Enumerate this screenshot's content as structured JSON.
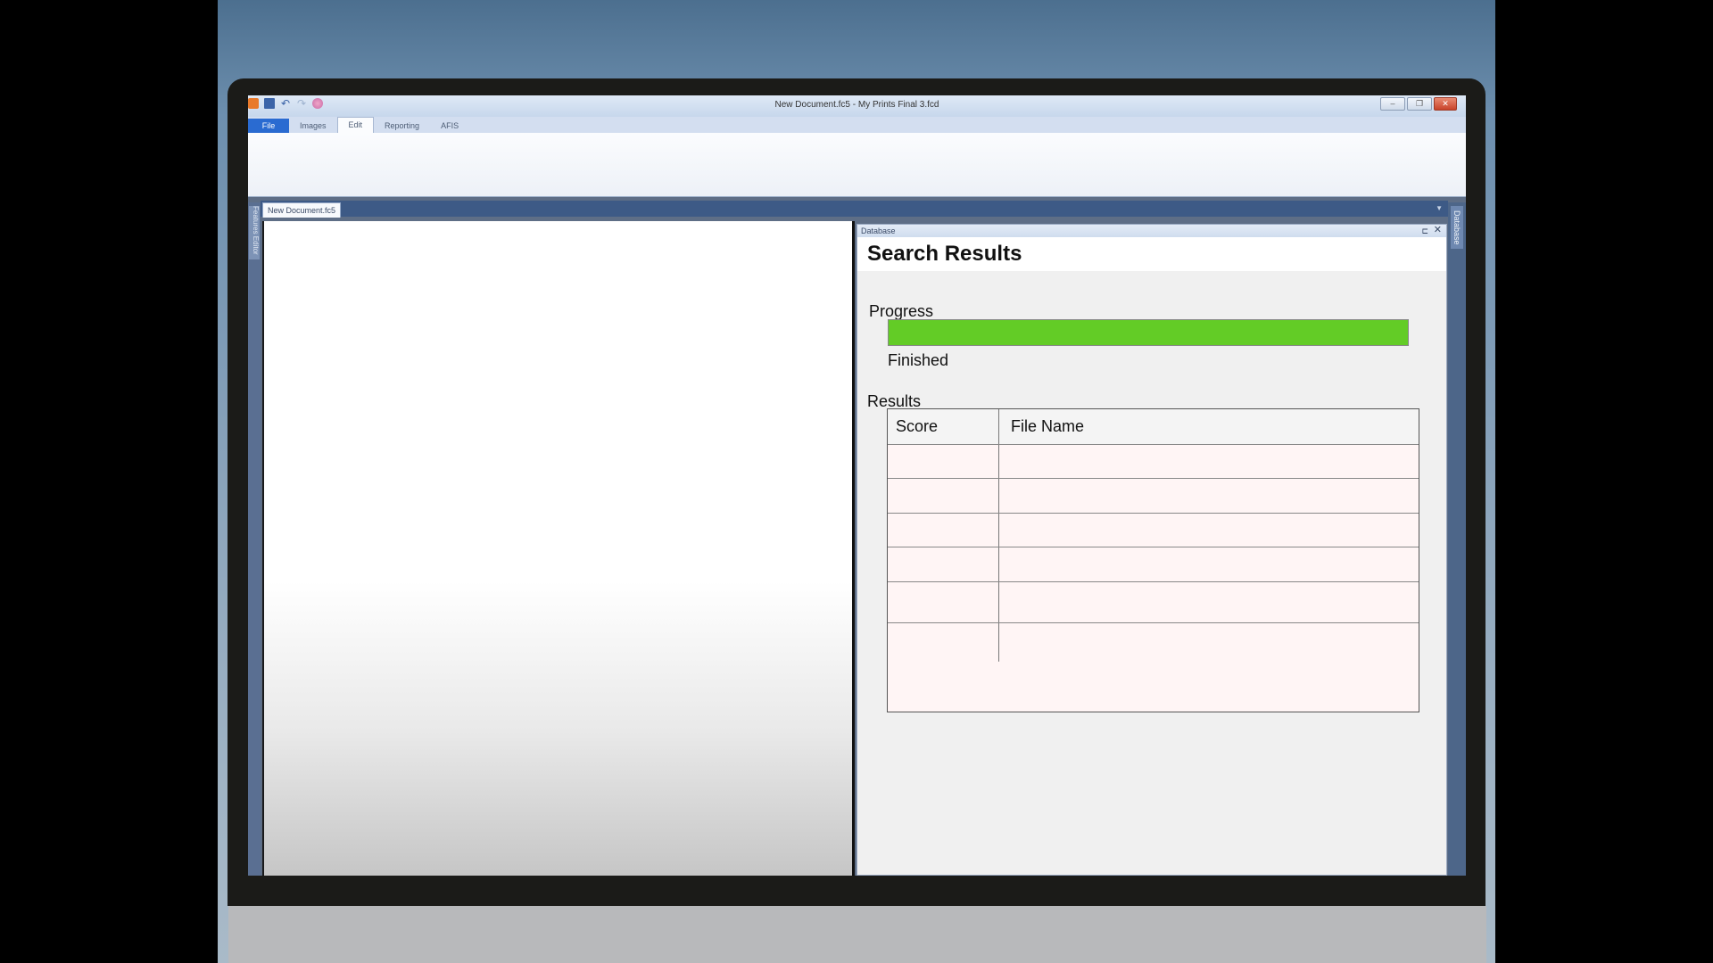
{
  "window": {
    "title": "New Document.fc5 - My Prints Final 3.fcd",
    "controls": [
      "minimize",
      "restore",
      "close"
    ]
  },
  "quick_access": [
    "app-icon",
    "save-icon",
    "undo-icon",
    "redo-icon",
    "fingerprint-icon"
  ],
  "ribbon": {
    "tabs": [
      {
        "label": "File",
        "state": "file"
      },
      {
        "label": "Images",
        "state": "normal"
      },
      {
        "label": "Edit",
        "state": "active"
      },
      {
        "label": "Reporting",
        "state": "normal"
      },
      {
        "label": "AFIS",
        "state": "normal"
      }
    ]
  },
  "left_panel": {
    "label": "Features Editor"
  },
  "right_panel": {
    "label": "Database"
  },
  "document": {
    "tab_label": "New Document.fc5"
  },
  "database_panel": {
    "header": "Database",
    "heading": "Search Results",
    "progress_label": "Progress",
    "progress_fraction": 1.0,
    "progress_status": "Finished",
    "results_label": "Results",
    "table": {
      "columns": [
        "Score",
        "File Name"
      ],
      "rows": [
        [
          "",
          ""
        ],
        [
          "",
          ""
        ],
        [
          "",
          ""
        ],
        [
          "",
          ""
        ],
        [
          "",
          ""
        ],
        [
          "",
          ""
        ]
      ]
    }
  },
  "colors": {
    "progress": "#63cc26",
    "table_cell": "#fff5f5",
    "file_tab": "#2a6bd1"
  }
}
